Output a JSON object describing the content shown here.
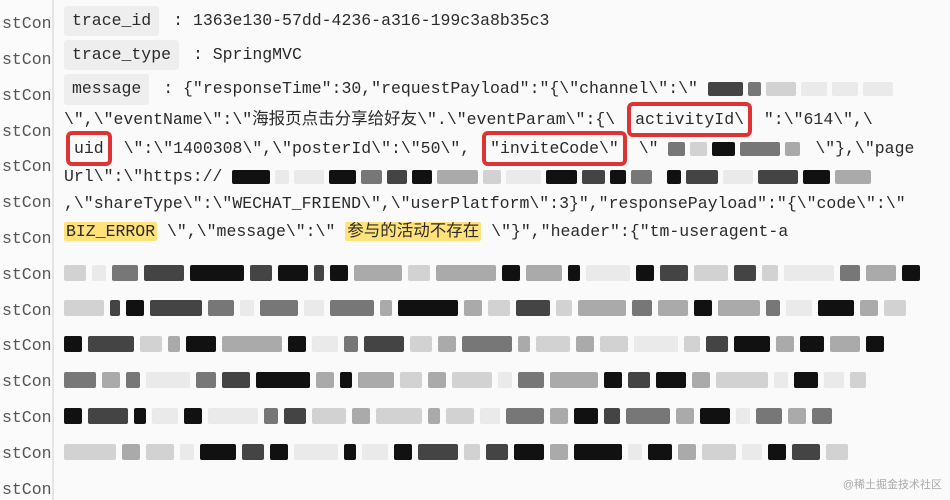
{
  "gutter_label": "stCon",
  "gutter_count": 14,
  "trace_id": {
    "key": "trace_id",
    "value": "1363e130-57dd-4236-a316-199c3a8b35c3"
  },
  "trace_type": {
    "key": "trace_type",
    "value": "SpringMVC"
  },
  "message_label": "message",
  "message_parts": {
    "pre": "{\"responseTime\":30,\"requestPayload\":\"{\\\"channel\\\":\\\" ",
    "seg1a": "\\\",\\\"eventName\\\":\\\"海报页点击分享给好友\\\".\\\"eventParam\\\":{\\",
    "box_activityId": "activityId\\",
    "seg1b": "\":\\\"614\\\",\\",
    "box_uid": "uid",
    "seg2a": "\\\":\\\"1400308\\\",\\\"posterId\\\":\\\"50\\\", ",
    "box_inviteCode": "\"inviteCode\\\"",
    "seg2b": " \\\" ",
    "seg2c": " \\\"},\\\"pageUrl\\\":\\\"https://",
    "seg3": " ,\\\"shareType\\\":\\\"WECHAT_FRIEND\\\",\\\"userPlatform\\\":3}\",\"responsePayload\":\"{\\\"code\\\":\\\"",
    "hl_biz": "BIZ_ERROR",
    "seg4": "\\\",\\\"message\\\":\\\"",
    "hl_msg": "参与的活动不存在",
    "seg5": "\\\"}\",\"header\":{\"tm-useragent-a"
  },
  "censored_blocks": [
    [
      22,
      14,
      26,
      40,
      54,
      22,
      30,
      10,
      18,
      48,
      22,
      60,
      18,
      36,
      12,
      44,
      18,
      28,
      34,
      22,
      16,
      50,
      20,
      30,
      18
    ],
    [
      40,
      10,
      18,
      52,
      26,
      14,
      38,
      20,
      44,
      12,
      60,
      18,
      22,
      34,
      16,
      48,
      20,
      30,
      18,
      42,
      14,
      26,
      36,
      18,
      22
    ],
    [
      18,
      46,
      22,
      12,
      30,
      60,
      18,
      26,
      14,
      40,
      22,
      18,
      50,
      12,
      34,
      18,
      28,
      44,
      16,
      22,
      36,
      18,
      24,
      30,
      18
    ],
    [
      32,
      18,
      14,
      44,
      20,
      28,
      54,
      18,
      12,
      36,
      22,
      18,
      40,
      14,
      26,
      48,
      18,
      22,
      30,
      18,
      52,
      14,
      24,
      20,
      16
    ],
    [
      18,
      40,
      12,
      26,
      18,
      50,
      14,
      22,
      34,
      18,
      46,
      12,
      28,
      20,
      38,
      18,
      24,
      16,
      44,
      18,
      30,
      14,
      26,
      18,
      20
    ],
    [
      52,
      18,
      28,
      14,
      36,
      22,
      18,
      44,
      12,
      26,
      18,
      40,
      16,
      22,
      30,
      18,
      48,
      14,
      24,
      18,
      34,
      20,
      18,
      28,
      22
    ]
  ],
  "shades": [
    "#111",
    "#444",
    "#777",
    "#aaa",
    "#d2d2d2",
    "#eaeaea"
  ],
  "watermark": "@稀土掘金技术社区"
}
